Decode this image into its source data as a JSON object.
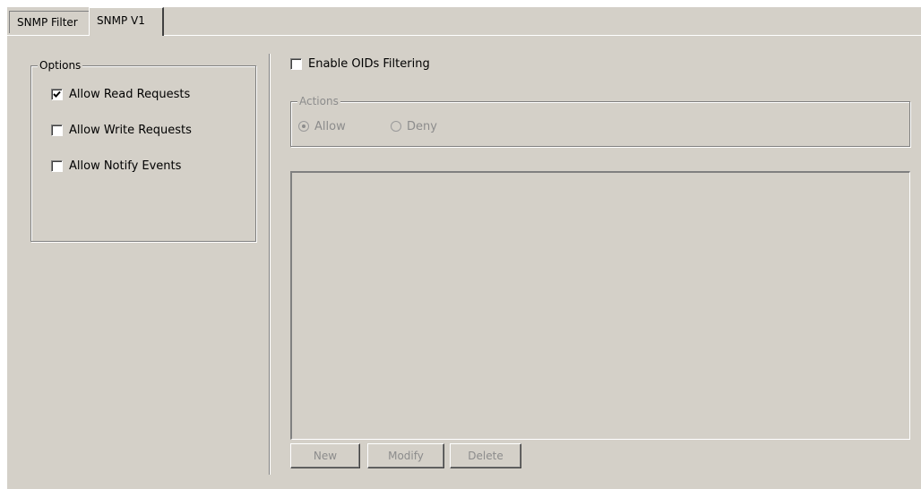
{
  "tabs": [
    {
      "label": "SNMP Filter",
      "active": false
    },
    {
      "label": "SNMP V1",
      "active": true
    }
  ],
  "options": {
    "title": "Options",
    "items": [
      {
        "label": "Allow Read Requests",
        "checked": true
      },
      {
        "label": "Allow Write Requests",
        "checked": false
      },
      {
        "label": "Allow Notify Events",
        "checked": false
      }
    ]
  },
  "oid_filter": {
    "enable_label": "Enable OIDs Filtering",
    "enabled": false
  },
  "actions": {
    "title": "Actions",
    "allow_label": "Allow",
    "deny_label": "Deny",
    "selected": "Allow",
    "disabled": true
  },
  "buttons": {
    "new_label": "New",
    "modify_label": "Modify",
    "delete_label": "Delete",
    "disabled": true
  },
  "colors": {
    "background": "#d4d0c8",
    "disabled_text": "#8c8c8c"
  }
}
